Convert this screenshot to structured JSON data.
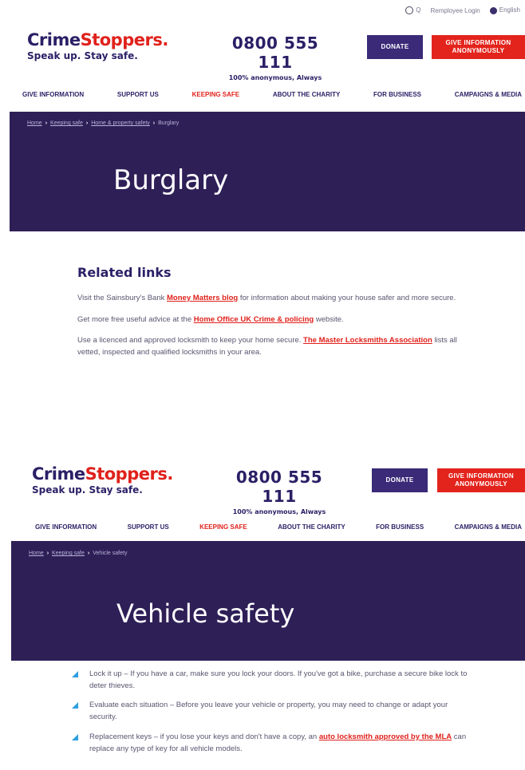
{
  "header": {
    "search_text": "Q",
    "account_label": "Remployee Login",
    "language_label": "English",
    "logo_name_a": "Crime",
    "logo_name_b": "Stoppers.",
    "logo_tagline": "Speak up. Stay safe.",
    "phone_number": "0800 555 111",
    "phone_subtitle": "100% anonymous, Always",
    "donate_label": "DONATE",
    "give_info_label": "GIVE INFORMATION ANONYMOUSLY"
  },
  "nav": {
    "items": [
      "GIVE INFORMATION",
      "SUPPORT US",
      "KEEPING SAFE",
      "ABOUT THE CHARITY",
      "FOR BUSINESS",
      "CAMPAIGNS & MEDIA"
    ]
  },
  "burglary": {
    "breadcrumbs": [
      "Home",
      "Keeping safe",
      "Home & property safety",
      "Burglary"
    ],
    "title": "Burglary",
    "related": {
      "heading": "Related links",
      "p1_before": "Visit the Sainsbury's Bank ",
      "p1_link": "Money Matters blog",
      "p1_after": " for information about making your house safer and more secure.",
      "p2_before": "Get more free useful advice at the ",
      "p2_link": "Home Office UK Crime & policing",
      "p2_after": " website.",
      "p3_before": "Use a licenced and approved locksmith to keep your home secure. ",
      "p3_link": "The Master Locksmiths Association",
      "p3_after": " lists all vetted, inspected and qualified locksmiths in your area."
    }
  },
  "vehicle": {
    "breadcrumbs": [
      "Home",
      "Keeping safe",
      "Vehicle safety"
    ],
    "title": "Vehicle safety",
    "bullets": [
      {
        "text": "Lock it up – If you have a car, make sure you lock your doors. If you've got a bike, purchase a secure bike lock to deter thieves."
      },
      {
        "text": "Evaluate each situation – Before you leave your vehicle or property, you may need to change or adapt your security."
      },
      {
        "before": "Replacement keys – if you lose your keys and don't have a copy, an ",
        "link": "auto locksmith approved by the MLA",
        "after": " can replace any type of key for all vehicle models."
      }
    ]
  },
  "colors": {
    "brand_navy": "#2b1f66",
    "brand_red": "#e0211b",
    "hero_purple": "#2e1f57",
    "bullet_blue": "#2d9fe0"
  }
}
